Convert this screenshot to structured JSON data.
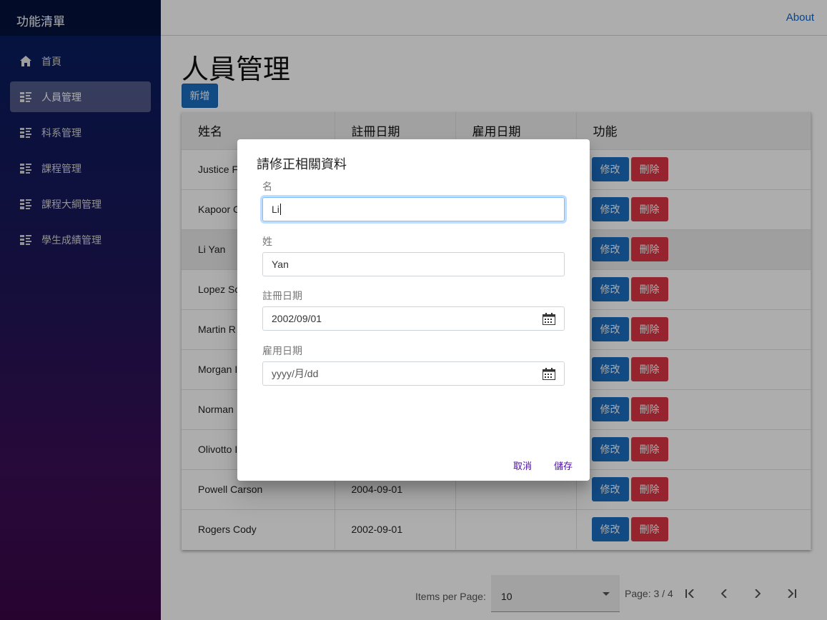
{
  "sidebar": {
    "brand": "功能清單",
    "items": [
      {
        "label": "首頁",
        "icon": "home-icon",
        "active": false
      },
      {
        "label": "人員管理",
        "icon": "list-icon",
        "active": true
      },
      {
        "label": "科系管理",
        "icon": "list-icon",
        "active": false
      },
      {
        "label": "課程管理",
        "icon": "list-icon",
        "active": false
      },
      {
        "label": "課程大綱管理",
        "icon": "list-icon",
        "active": false
      },
      {
        "label": "學生成績管理",
        "icon": "list-icon",
        "active": false
      }
    ]
  },
  "topbar": {
    "about": "About"
  },
  "page": {
    "title": "人員管理",
    "add_label": "新增"
  },
  "table": {
    "headers": [
      "姓名",
      "註冊日期",
      "雇用日期",
      "功能"
    ],
    "edit_label": "修改",
    "delete_label": "刪除",
    "rows": [
      {
        "name": "Justice F",
        "enroll": "",
        "hire": ""
      },
      {
        "name": "Kapoor C",
        "enroll": "",
        "hire": ""
      },
      {
        "name": "Li Yan",
        "enroll": "",
        "hire": ""
      },
      {
        "name": "Lopez Sc",
        "enroll": "",
        "hire": ""
      },
      {
        "name": "Martin R",
        "enroll": "",
        "hire": ""
      },
      {
        "name": "Morgan I",
        "enroll": "",
        "hire": ""
      },
      {
        "name": "Norman",
        "enroll": "",
        "hire": ""
      },
      {
        "name": "Olivotto I",
        "enroll": "",
        "hire": ""
      },
      {
        "name": "Powell Carson",
        "enroll": "2004-09-01",
        "hire": ""
      },
      {
        "name": "Rogers Cody",
        "enroll": "2002-09-01",
        "hire": ""
      }
    ]
  },
  "pager": {
    "items_per_page_label": "Items per Page:",
    "items_per_page_value": "10",
    "page_text": "Page: 3 / 4"
  },
  "dialog": {
    "title": "請修正相關資料",
    "first_name_label": "名",
    "first_name_value": "Li",
    "last_name_label": "姓",
    "last_name_value": "Yan",
    "enroll_label": "註冊日期",
    "enroll_value": "2002/09/01",
    "hire_label": "雇用日期",
    "hire_placeholder": "yyyy/月/dd",
    "cancel_label": "取消",
    "save_label": "儲存"
  }
}
